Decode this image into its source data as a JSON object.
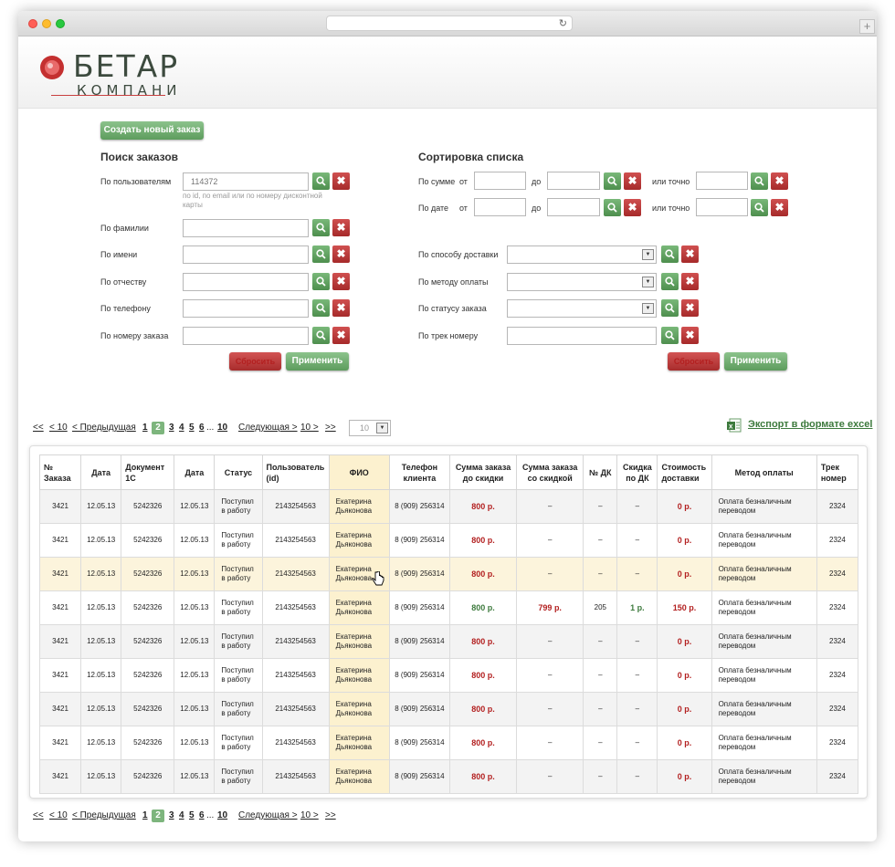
{
  "logo": {
    "title": "БЕТАР",
    "subtitle": "КОМПАНИ"
  },
  "create_button": "Создать новый заказ",
  "search": {
    "title": "Поиск заказов",
    "by_user": {
      "label": "По пользователям",
      "placeholder": "114372",
      "hint": "по id, по email или по номеру дисконтной карты"
    },
    "by_surname": "По фамилии",
    "by_name": "По имени",
    "by_patronymic": "По отчеству",
    "by_phone": "По телефону",
    "by_order": "По номеру заказа",
    "reset": "Сбросить",
    "apply": "Применить"
  },
  "sort": {
    "title": "Сортировка списка",
    "by_sum": "По сумме",
    "by_date": "По дате",
    "from": "от",
    "to": "до",
    "or_exact": "или точно",
    "by_delivery": "По способу доставки",
    "by_payment": "По методу оплаты",
    "by_status": "По статусу заказа",
    "by_track": "По трек номеру",
    "reset": "Сбросить",
    "apply": "Применить"
  },
  "pager": {
    "first": "<<",
    "back10": "< 10",
    "prev": "< Предыдущая",
    "pages": [
      "1",
      "2",
      "3",
      "4",
      "5",
      "6"
    ],
    "current": "2",
    "ellipsis": "...",
    "last": "10",
    "next": "Следующая >",
    "fwd10": "10 >",
    "end": ">>",
    "per_page": "10"
  },
  "export": "Экспорт в формате excel",
  "table": {
    "headers": [
      "№ Заказа",
      "Дата",
      "Документ 1С",
      "Дата",
      "Статус",
      "Пользователь (id)",
      "ФИО",
      "Телефон клиента",
      "Сумма заказа до скидки",
      "Сумма заказа со скидкой",
      "№ ДК",
      "Скидка по ДК",
      "Стоимость доставки",
      "Метод оплаты",
      "Трек номер"
    ],
    "rows": [
      [
        "3421",
        "12.05.13",
        "5242326",
        "12.05.13",
        "Поступил в работу",
        "2143254563",
        "Екатерина Дьяконова",
        "8 (909) 256314",
        "800 р.",
        "–",
        "–",
        "–",
        "0 р.",
        "Оплата безналичным переводом",
        "2324"
      ],
      [
        "3421",
        "12.05.13",
        "5242326",
        "12.05.13",
        "Поступил в работу",
        "2143254563",
        "Екатерина Дьяконова",
        "8 (909) 256314",
        "800 р.",
        "–",
        "–",
        "–",
        "0 р.",
        "Оплата безналичным переводом",
        "2324"
      ],
      [
        "3421",
        "12.05.13",
        "5242326",
        "12.05.13",
        "Поступил в работу",
        "2143254563",
        "Екатерина Дьяконова",
        "8 (909) 256314",
        "800 р.",
        "–",
        "–",
        "–",
        "0 р.",
        "Оплата безналичным переводом",
        "2324"
      ],
      [
        "3421",
        "12.05.13",
        "5242326",
        "12.05.13",
        "Поступил в работу",
        "2143254563",
        "Екатерина Дьяконова",
        "8 (909) 256314",
        "800 р.",
        "799 р.",
        "205",
        "1 р.",
        "150 р.",
        "Оплата безналичным переводом",
        "2324"
      ],
      [
        "3421",
        "12.05.13",
        "5242326",
        "12.05.13",
        "Поступил в работу",
        "2143254563",
        "Екатерина Дьяконова",
        "8 (909) 256314",
        "800 р.",
        "–",
        "–",
        "–",
        "0 р.",
        "Оплата безналичным переводом",
        "2324"
      ],
      [
        "3421",
        "12.05.13",
        "5242326",
        "12.05.13",
        "Поступил в работу",
        "2143254563",
        "Екатерина Дьяконова",
        "8 (909) 256314",
        "800 р.",
        "–",
        "–",
        "–",
        "0 р.",
        "Оплата безналичным переводом",
        "2324"
      ],
      [
        "3421",
        "12.05.13",
        "5242326",
        "12.05.13",
        "Поступил в работу",
        "2143254563",
        "Екатерина Дьяконова",
        "8 (909) 256314",
        "800 р.",
        "–",
        "–",
        "–",
        "0 р.",
        "Оплата безналичным переводом",
        "2324"
      ],
      [
        "3421",
        "12.05.13",
        "5242326",
        "12.05.13",
        "Поступил в работу",
        "2143254563",
        "Екатерина Дьяконова",
        "8 (909) 256314",
        "800 р.",
        "–",
        "–",
        "–",
        "0 р.",
        "Оплата безналичным переводом",
        "2324"
      ],
      [
        "3421",
        "12.05.13",
        "5242326",
        "12.05.13",
        "Поступил в работу",
        "2143254563",
        "Екатерина Дьяконова",
        "8 (909) 256314",
        "800 р.",
        "–",
        "–",
        "–",
        "0 р.",
        "Оплата безналичным переводом",
        "2324"
      ]
    ]
  }
}
